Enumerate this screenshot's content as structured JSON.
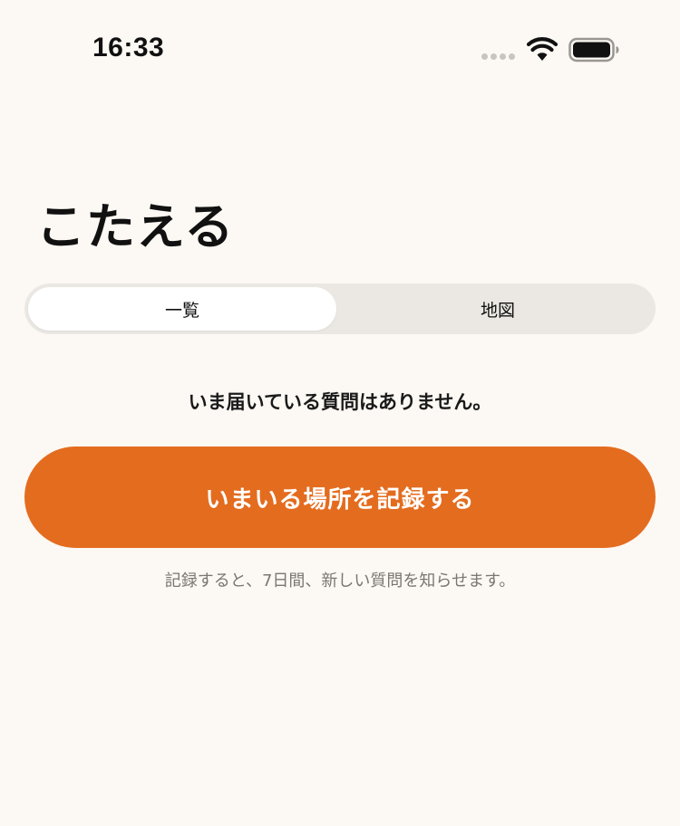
{
  "status_bar": {
    "time": "16:33"
  },
  "header": {
    "title": "こたえる"
  },
  "segmented_control": {
    "items": [
      {
        "label": "一覧",
        "selected": true
      },
      {
        "label": "地図",
        "selected": false
      }
    ]
  },
  "main": {
    "empty_message": "いま届いている質問はありません。",
    "record_button_label": "いまいる場所を記録する",
    "note": "記録すると、7日間、新しい質問を知らせます。"
  },
  "colors": {
    "background": "#FCF8F3",
    "accent": "#E46C1F",
    "segment_track": "#EBE8E3",
    "segment_active": "#FFFFFF",
    "note_text": "#7A7672"
  },
  "icons": [
    "cellular-signal-icon",
    "wifi-icon",
    "battery-icon"
  ]
}
